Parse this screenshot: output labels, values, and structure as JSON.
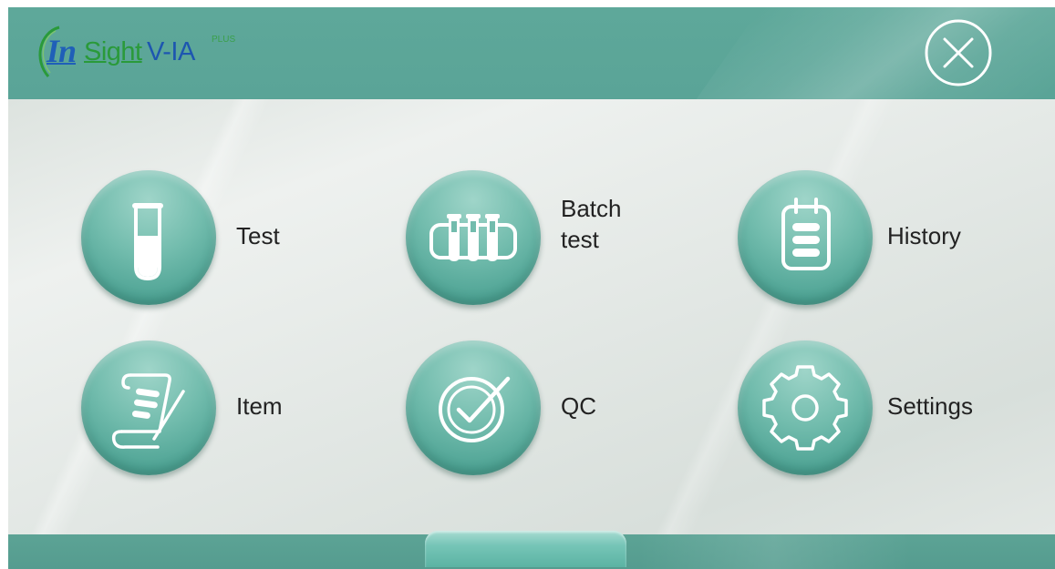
{
  "header": {
    "logo": {
      "part_in": "In",
      "part_sight": "Sight",
      "part_model": "V-IA",
      "part_plus": "PLUS"
    },
    "close_icon": "close-circle-icon"
  },
  "menu": {
    "test": {
      "label": "Test",
      "icon": "test-tube-icon"
    },
    "batch_test": {
      "label_line1": "Batch",
      "label_line2": "test",
      "icon": "test-tube-rack-icon"
    },
    "history": {
      "label": "History",
      "icon": "clipboard-list-icon"
    },
    "item": {
      "label": "Item",
      "icon": "scroll-pen-icon"
    },
    "qc": {
      "label": "QC",
      "icon": "check-circle-icon"
    },
    "settings": {
      "label": "Settings",
      "icon": "gear-icon"
    }
  },
  "colors": {
    "header_bar": "#5ea89a",
    "button_teal": "#72bcad",
    "logo_blue": "#1f5fb8",
    "logo_green": "#2a9a3a",
    "label_text": "#222222"
  }
}
